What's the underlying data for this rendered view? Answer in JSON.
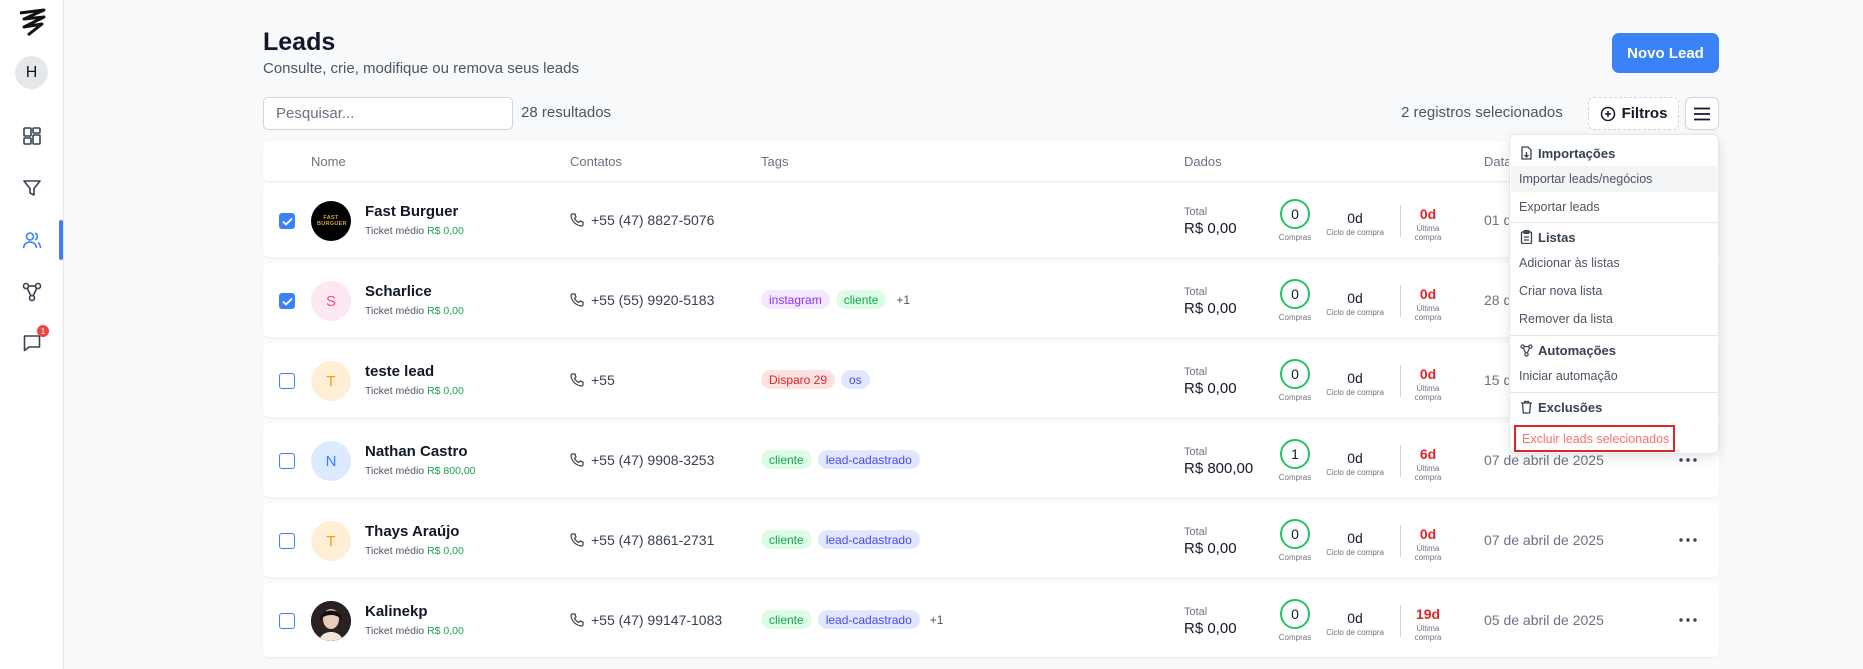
{
  "sidebar": {
    "avatar_initial": "H",
    "notification_count": "1",
    "accent": "#3b82f6",
    "icons": [
      "dashboard-icon",
      "funnel-icon",
      "users-icon",
      "automation-icon",
      "chat-icon"
    ]
  },
  "header": {
    "title": "Leads",
    "subtitle": "Consulte, crie, modifique ou remova seus leads",
    "new_button": "Novo Lead"
  },
  "toolbar": {
    "search_placeholder": "Pesquisar...",
    "results": "28 resultados",
    "selected": "2 registros selecionados",
    "filter_label": "Filtros"
  },
  "table": {
    "columns": {
      "name": "Nome",
      "contacts": "Contatos",
      "tags": "Tags",
      "data": "Dados",
      "date": "Data"
    },
    "labels": {
      "ticket": "Ticket médio",
      "total": "Total",
      "compras": "Compras",
      "ciclo": "Ciclo de compra",
      "ultima_1": "Última",
      "ultima_2": "compra"
    },
    "rows": [
      {
        "name": "Fast Burguer",
        "avatar": "FAST BURGUER",
        "ticket": "R$ 0,00",
        "phone": "+55 (47) 8827-5076",
        "tags": [],
        "more": "",
        "total": "R$ 0,00",
        "compras": "0",
        "ciclo": "0d",
        "ultima": "0d",
        "date": "01 de",
        "checked": true
      },
      {
        "name": "Scharlice",
        "avatar": "S",
        "ticket": "R$ 0,00",
        "phone": "+55 (55) 9920-5183",
        "tags": [
          "instagram",
          "cliente"
        ],
        "more": "+1",
        "total": "R$ 0,00",
        "compras": "0",
        "ciclo": "0d",
        "ultima": "0d",
        "date": "28 d",
        "checked": true
      },
      {
        "name": "teste lead",
        "avatar": "T",
        "ticket": "R$ 0,00",
        "phone": "+55",
        "tags": [
          "Disparo 29",
          "os"
        ],
        "more": "",
        "total": "R$ 0,00",
        "compras": "0",
        "ciclo": "0d",
        "ultima": "0d",
        "date": "15 d",
        "checked": false
      },
      {
        "name": "Nathan Castro",
        "avatar": "N",
        "ticket": "R$ 800,00",
        "phone": "+55 (47) 9908-3253",
        "tags": [
          "cliente",
          "lead-cadastrado"
        ],
        "more": "",
        "total": "R$ 800,00",
        "compras": "1",
        "ciclo": "0d",
        "ultima": "6d",
        "date": "07 de abril de 2025",
        "checked": false
      },
      {
        "name": "Thays Araújo",
        "avatar": "T",
        "ticket": "R$ 0,00",
        "phone": "+55 (47) 8861-2731",
        "tags": [
          "cliente",
          "lead-cadastrado"
        ],
        "more": "",
        "total": "R$ 0,00",
        "compras": "0",
        "ciclo": "0d",
        "ultima": "0d",
        "date": "07 de abril de 2025",
        "checked": false
      },
      {
        "name": "Kalinekp",
        "avatar": "",
        "ticket": "R$ 0,00",
        "phone": "+55 (47) 99147-1083",
        "tags": [
          "cliente",
          "lead-cadastrado"
        ],
        "more": "+1",
        "total": "R$ 0,00",
        "compras": "0",
        "ciclo": "0d",
        "ultima": "19d",
        "date": "05 de abril de 2025",
        "checked": false
      }
    ]
  },
  "menu": {
    "importacoes": "Importações",
    "importar": "Importar leads/negócios",
    "exportar": "Exportar leads",
    "listas": "Listas",
    "adicionar": "Adicionar às listas",
    "criar": "Criar nova lista",
    "remover": "Remover da lista",
    "automacoes": "Automações",
    "iniciar": "Iniciar automação",
    "exclusoes": "Exclusões",
    "excluir": "Excluir leads selecionados"
  }
}
